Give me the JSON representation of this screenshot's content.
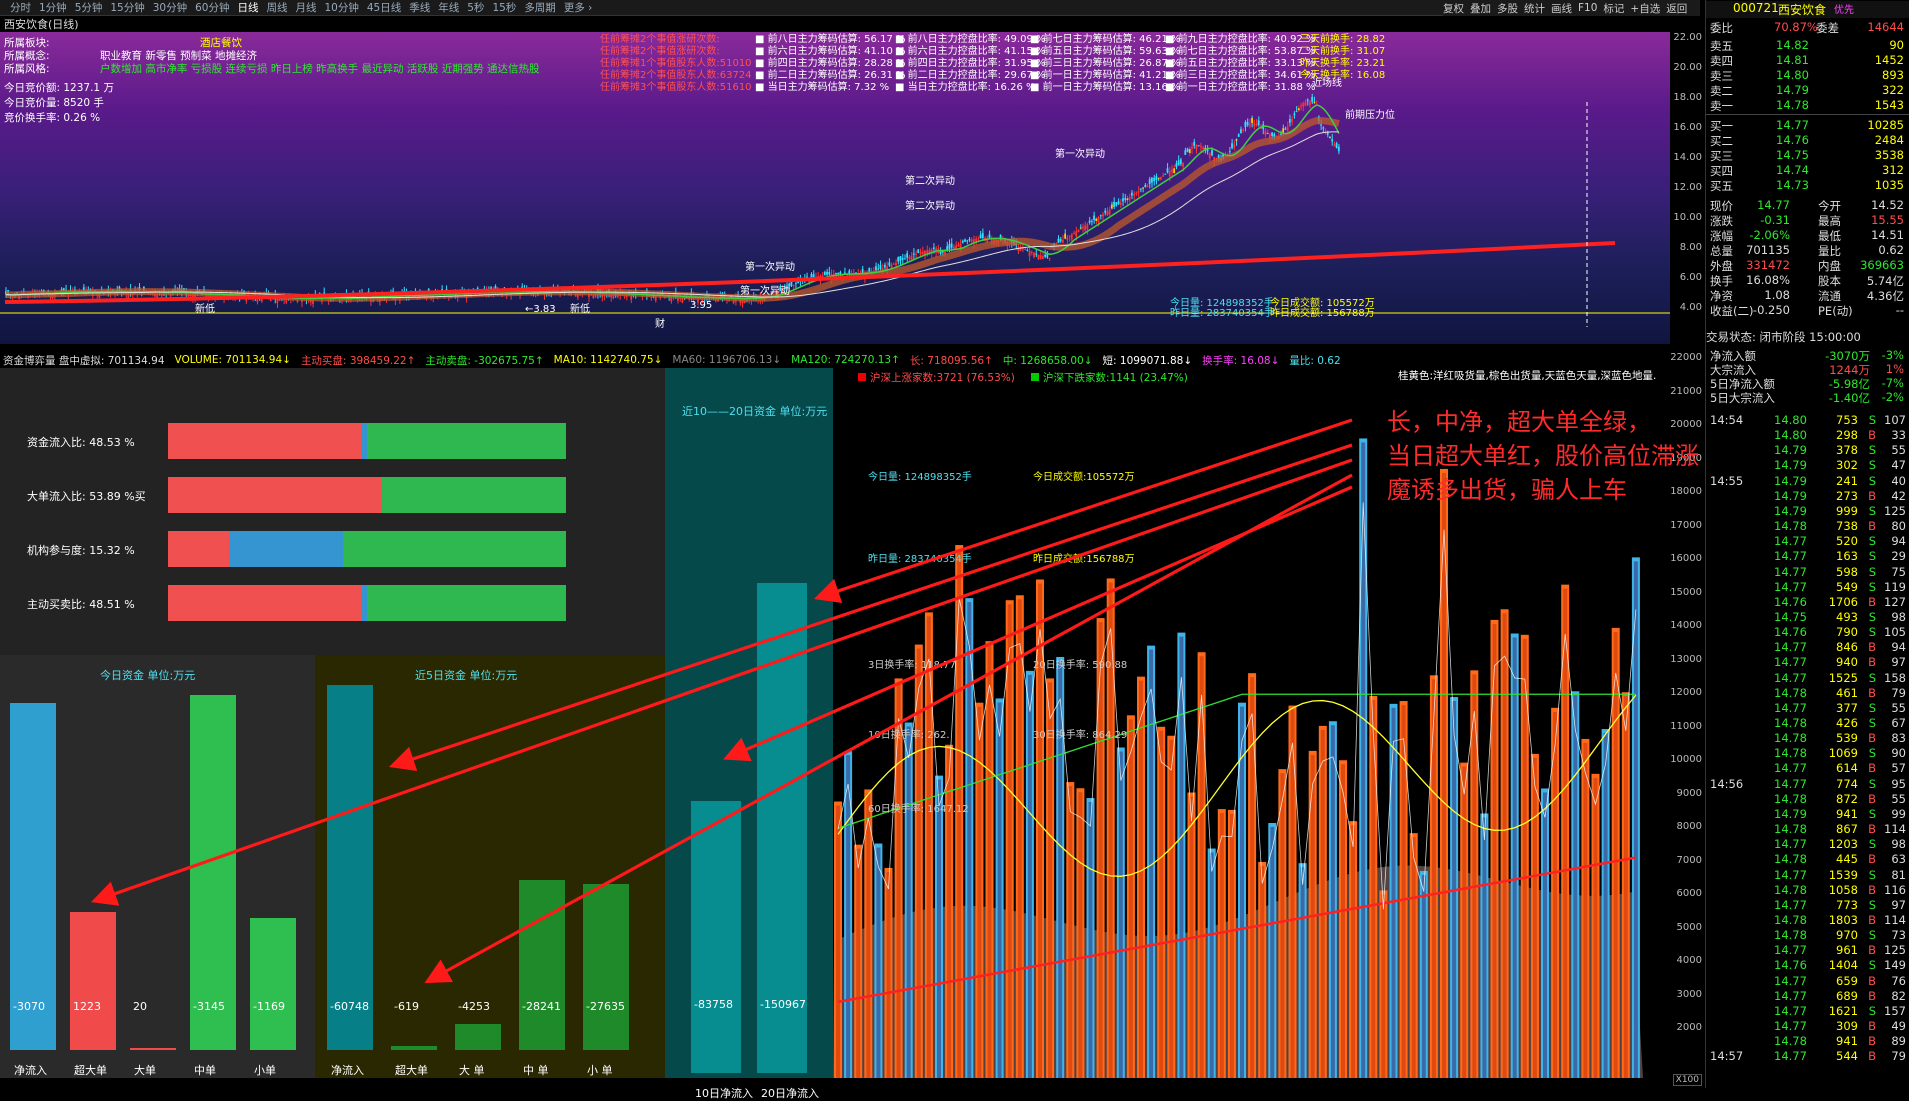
{
  "topbar": {
    "periods": [
      "分时",
      "1分钟",
      "5分钟",
      "15分钟",
      "30分钟",
      "60分钟",
      "日线",
      "周线",
      "月线",
      "10分钟",
      "45日线",
      "季线",
      "年线",
      "5秒",
      "15秒",
      "多周期",
      "更多 ›"
    ],
    "selected": "日线",
    "tools": [
      "复权",
      "叠加",
      "多股",
      "统计",
      "画线",
      "F10",
      "标记",
      "+自选",
      "返回"
    ]
  },
  "window_title": "西安饮食(日线)",
  "kinfo": {
    "rows": [
      {
        "k": "所属板块:",
        "v": "酒店餐饮"
      },
      {
        "k": "所属概念:",
        "v": "职业教育 新零售 预制菜 地摊经济"
      },
      {
        "k": "所属风格:",
        "v": "户数增加 高市净率 亏损股 连续亏损 昨日上榜 昨高换手 最近异动 活跃股 近期强势 通达信热股"
      }
    ],
    "bid_amount": "今日竞价额: 1237.1 万",
    "bid_volume": "今日竞价量: 8520 手",
    "bid_turnover": "竞价换手率: 0.26 %"
  },
  "kpink": [
    "任前筹摊2个事值涨研次数:",
    "任前筹摊2个事值涨研次数:",
    "任前筹摊1个事值股东人数:51010",
    "任前筹摊2个事值股东人数:63724",
    "任前筹摊3个事值股东人数:51610"
  ],
  "kcol1": [
    "前八日主力筹码估算: 56.17 %",
    "前六日主力筹码估算: 41.10 %",
    "前四日主力筹码估算: 28.28 %",
    "前二日主力筹码估算: 26.31 %",
    "当日主力筹码估算: 7.32 %"
  ],
  "kcol2": [
    "前八日主力控盘比率: 49.09 %",
    "前六日主力控盘比率: 41.15 %",
    "前四日主力控盘比率: 31.95 %",
    "前二日主力控盘比率: 29.67 %",
    "当日主力控盘比率: 16.26 %"
  ],
  "kcol3": [
    "前七日主力筹码估算: 46.21 %",
    "前五日主力筹码估算: 59.63 %",
    "前三日主力筹码估算: 26.87 %",
    "前一日主力筹码估算: 41.21 %",
    "前一日主力筹码估算: 13.16 %"
  ],
  "kcol4": [
    "前九日主力控盘比率: 40.92 %",
    "前七日主力控盘比率: 53.87 %",
    "前五日主力控盘比率: 33.13 %",
    "前三日主力控盘比率: 34.61 %",
    "前一日主力控盘比率: 31.88 %"
  ],
  "kcol5": [
    "三天前换手: 28.82",
    "二天前换手: 31.07",
    "昨天换手率: 23.21",
    "今天换手率: 16.08"
  ],
  "kannot": [
    "第二次异动",
    "第一次异动",
    "第二次异动",
    "第一次异动",
    "第一次异动",
    "前期压力位",
    "近场线",
    "新低",
    "新低",
    "←3.83",
    "3.95",
    "财"
  ],
  "kaxis": [
    "22.00",
    "20.00",
    "18.00",
    "16.00",
    "14.00",
    "12.00",
    "10.00",
    "8.00",
    "6.00",
    "4.00"
  ],
  "kbottom": [
    "今日量: 124898352手",
    "昨日量: 283740354手",
    "今日成交额: 105572万",
    "昨日成交额: 156788万"
  ],
  "status": {
    "items": [
      {
        "t": "资金博弈量 盘中虚拟: 701134.94",
        "c": "#ddd"
      },
      {
        "t": "VOLUME: 701134.94↓",
        "c": "#ff0"
      },
      {
        "t": "主动买盘: 398459.22↑",
        "c": "#ff4d4d"
      },
      {
        "t": "主动卖盘: -302675.75↑",
        "c": "#2ee82e"
      },
      {
        "t": "MA10: 1142740.75↓",
        "c": "#ff0"
      },
      {
        "t": "MA60: 1196706.13↓",
        "c": "#888"
      },
      {
        "t": "MA120: 724270.13↑",
        "c": "#2ee82e"
      },
      {
        "t": "长: 718095.56↑",
        "c": "#ff4d4d"
      },
      {
        "t": "中: 1268658.00↓",
        "c": "#2ee82e"
      },
      {
        "t": "短: 1099071.88↓",
        "c": "#fff"
      },
      {
        "t": "换手率: 16.08↓",
        "c": "#ff40ff"
      },
      {
        "t": "量比: 0.62",
        "c": "#4ee0f0"
      }
    ]
  },
  "midbars": [
    {
      "label": "资金流入比: 48.53 %",
      "red": 0.4853,
      "blue": 0.015,
      "green": 0.4997
    },
    {
      "label": "大单流入比: 53.89 %买",
      "red": 0.5389,
      "blue": 0.0,
      "green": 0.4611
    },
    {
      "label": "机构参与度: 15.32 %",
      "red": 0.1532,
      "blue": 0.2868,
      "green": 0.56
    },
    {
      "label": "主动买卖比: 48.51 %",
      "red": 0.4851,
      "blue": 0.015,
      "green": 0.4999
    }
  ],
  "ten": {
    "title": "近10——20日资金 单位:万元",
    "vals": [
      "-83758",
      "-150967"
    ],
    "labels": [
      "10日净流入",
      "20日净流入"
    ],
    "heights": [
      83758,
      150967
    ]
  },
  "today": {
    "title": "今日资金 单位:万元",
    "vals": [
      "-3070",
      "1223",
      "20",
      "-3145",
      "-1169"
    ],
    "labels": [
      "净流入",
      "超大单",
      "大单",
      "中单",
      "小单"
    ],
    "amounts": [
      3070,
      1223,
      20,
      3145,
      1169
    ],
    "colors": [
      "#2f9fd0",
      "#f04a4a",
      "#f04a4a",
      "#2fbf50",
      "#2fbf50"
    ]
  },
  "five": {
    "title": "近5日资金 单位:万元",
    "vals": [
      "-60748",
      "-619",
      "-4253",
      "-28241",
      "-27635"
    ],
    "labels": [
      "净流入",
      "超大单",
      "大 单",
      "中 单",
      "小 单"
    ],
    "amounts": [
      60748,
      619,
      4253,
      28241,
      27635
    ],
    "colors": [
      "#077f86",
      "#1f8a2a",
      "#1f8a2a",
      "#1f8a2a",
      "#1f8a2a"
    ]
  },
  "vol": {
    "legend": "桂黄色:洋红吸货量,棕色出货量,天蓝色天量,深蓝色地量.",
    "up": "沪深上涨家数:3721 (76.53%)",
    "down": "沪深下跌家数:1141 (23.47%)",
    "labels": [
      "今日量: 124898352手",
      "今日成交额:105572万",
      "昨日量: 283740354手",
      "昨日成交额:156788万",
      "3日换手率: 118.77",
      "20日换手率: 590.88",
      "10日换手率: 262.",
      "30日换手率: 864.29",
      "60日换手率: 1647.12"
    ],
    "axis": [
      "22000",
      "21000",
      "20000",
      "19000",
      "18000",
      "17000",
      "16000",
      "15000",
      "14000",
      "13000",
      "12000",
      "11000",
      "10000",
      "9000",
      "8000",
      "7000",
      "6000",
      "5000",
      "4000",
      "3000",
      "2000"
    ],
    "x100": "X100"
  },
  "overlay": [
    "长，中净，超大单全绿，",
    "当日超大单红，股价高位滞涨",
    "魔诱多出货，骗人上车"
  ],
  "quote": {
    "code": "000721",
    "name": "西安饮食",
    "tag": "优先",
    "weibi": "70.87%",
    "weicha": "14644",
    "asks": [
      [
        "卖五",
        "14.82",
        "90"
      ],
      [
        "卖四",
        "14.81",
        "1452"
      ],
      [
        "卖三",
        "14.80",
        "893"
      ],
      [
        "卖二",
        "14.79",
        "322"
      ],
      [
        "卖一",
        "14.78",
        "1543"
      ]
    ],
    "bids": [
      [
        "买一",
        "14.77",
        "10285"
      ],
      [
        "买二",
        "14.76",
        "2484"
      ],
      [
        "买三",
        "14.75",
        "3538"
      ],
      [
        "买四",
        "14.74",
        "312"
      ],
      [
        "买五",
        "14.73",
        "1035"
      ]
    ],
    "stats": [
      [
        "现价",
        "14.77",
        "今开",
        "14.52"
      ],
      [
        "涨跌",
        "-0.31",
        "最高",
        "15.55"
      ],
      [
        "涨幅",
        "-2.06%",
        "最低",
        "14.51"
      ],
      [
        "总量",
        "701135",
        "量比",
        "0.62"
      ],
      [
        "外盘",
        "331472",
        "内盘",
        "369663"
      ],
      [
        "换手",
        "16.08%",
        "股本",
        "5.74亿"
      ],
      [
        "净资",
        "1.08",
        "流通",
        "4.36亿"
      ],
      [
        "收益(二)",
        "-0.250",
        "PE(动)",
        "--"
      ]
    ],
    "trade_state": "交易状态: 闭市阶段 15:00:00",
    "flows": [
      [
        "净流入额",
        "-3070万",
        "-3%"
      ],
      [
        "大宗流入",
        "1244万",
        "1%"
      ],
      [
        "5日净流入额",
        "-5.98亿",
        "-7%"
      ],
      [
        "5日大宗流入",
        "-1.40亿",
        "-2%"
      ]
    ],
    "ticks": [
      [
        "14:54",
        "14.80",
        "753",
        "S",
        "107"
      ],
      [
        "",
        "14.80",
        "298",
        "B",
        "33"
      ],
      [
        "",
        "14.79",
        "378",
        "S",
        "55"
      ],
      [
        "",
        "14.79",
        "302",
        "S",
        "47"
      ],
      [
        "14:55",
        "14.79",
        "241",
        "S",
        "40"
      ],
      [
        "",
        "14.79",
        "273",
        "B",
        "42"
      ],
      [
        "",
        "14.79",
        "999",
        "S",
        "125"
      ],
      [
        "",
        "14.78",
        "738",
        "B",
        "80"
      ],
      [
        "",
        "14.77",
        "520",
        "S",
        "94"
      ],
      [
        "",
        "14.77",
        "163",
        "S",
        "29"
      ],
      [
        "",
        "14.77",
        "598",
        "S",
        "75"
      ],
      [
        "",
        "14.77",
        "549",
        "S",
        "119"
      ],
      [
        "",
        "14.76",
        "1706",
        "B",
        "127"
      ],
      [
        "",
        "14.75",
        "493",
        "S",
        "98"
      ],
      [
        "",
        "14.76",
        "790",
        "S",
        "105"
      ],
      [
        "",
        "14.77",
        "846",
        "B",
        "94"
      ],
      [
        "",
        "14.77",
        "940",
        "B",
        "97"
      ],
      [
        "",
        "14.77",
        "1525",
        "S",
        "158"
      ],
      [
        "",
        "14.78",
        "461",
        "B",
        "79"
      ],
      [
        "",
        "14.77",
        "377",
        "S",
        "55"
      ],
      [
        "",
        "14.78",
        "426",
        "S",
        "67"
      ],
      [
        "",
        "14.78",
        "539",
        "B",
        "83"
      ],
      [
        "",
        "14.78",
        "1069",
        "S",
        "90"
      ],
      [
        "",
        "14.77",
        "614",
        "B",
        "57"
      ],
      [
        "14:56",
        "14.77",
        "774",
        "S",
        "95"
      ],
      [
        "",
        "14.78",
        "872",
        "B",
        "55"
      ],
      [
        "",
        "14.79",
        "941",
        "S",
        "99"
      ],
      [
        "",
        "14.78",
        "867",
        "B",
        "114"
      ],
      [
        "",
        "14.77",
        "1203",
        "S",
        "98"
      ],
      [
        "",
        "14.78",
        "445",
        "B",
        "63"
      ],
      [
        "",
        "14.77",
        "1539",
        "S",
        "81"
      ],
      [
        "",
        "14.78",
        "1058",
        "B",
        "116"
      ],
      [
        "",
        "14.77",
        "773",
        "S",
        "97"
      ],
      [
        "",
        "14.78",
        "1803",
        "B",
        "114"
      ],
      [
        "",
        "14.78",
        "970",
        "S",
        "73"
      ],
      [
        "",
        "14.77",
        "961",
        "B",
        "125"
      ],
      [
        "",
        "14.76",
        "1404",
        "S",
        "149"
      ],
      [
        "",
        "14.77",
        "659",
        "B",
        "76"
      ],
      [
        "",
        "14.77",
        "689",
        "B",
        "82"
      ],
      [
        "",
        "14.77",
        "1621",
        "S",
        "157"
      ],
      [
        "",
        "14.77",
        "309",
        "B",
        "49"
      ],
      [
        "",
        "14.78",
        "941",
        "B",
        "89"
      ],
      [
        "14:57",
        "14.77",
        "544",
        "B",
        "79"
      ]
    ]
  }
}
